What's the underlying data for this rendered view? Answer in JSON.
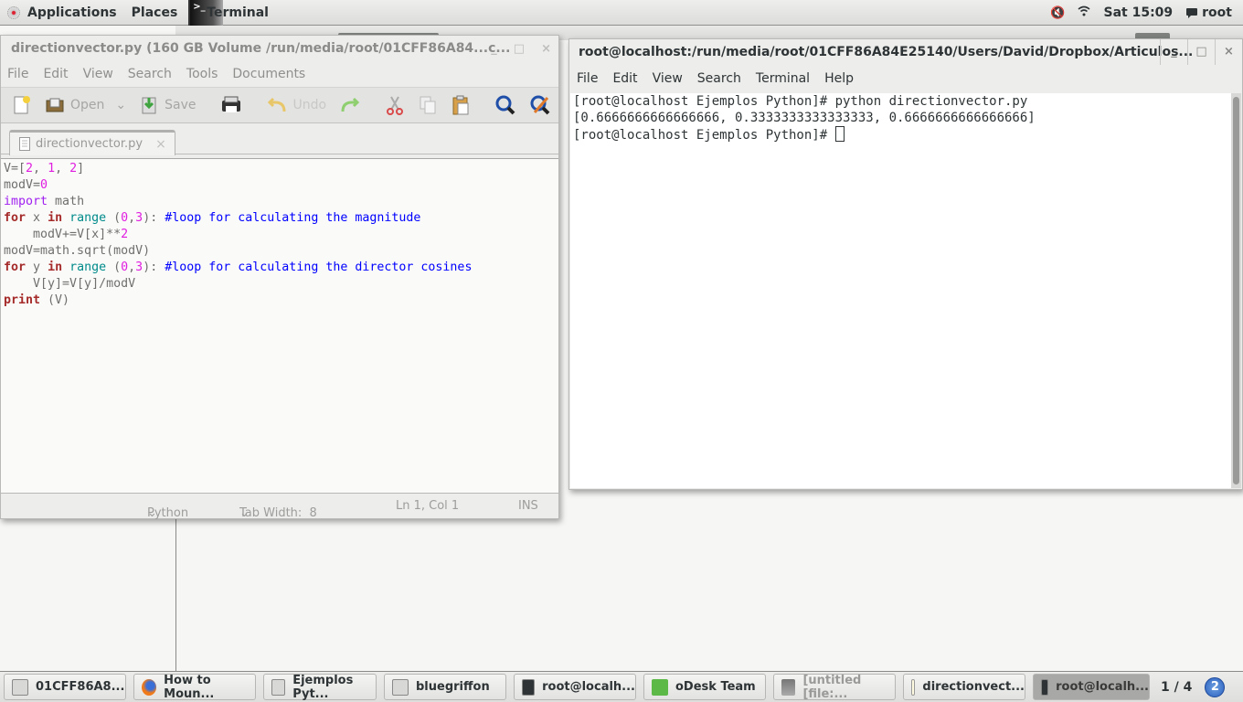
{
  "top_panel": {
    "applications": "Applications",
    "places": "Places",
    "active_app": "Terminal",
    "volume_icon": "volume-muted-icon",
    "wifi_icon": "wifi-icon",
    "clock": "Sat 15:09",
    "chat_icon": "chat-bubble-icon",
    "user": "root"
  },
  "gedit": {
    "title": "directionvector.py (160 GB Volume /run/media/root/01CFF86A84...c...",
    "controls": [
      "_",
      "□",
      "×"
    ],
    "menu": [
      "File",
      "Edit",
      "View",
      "Search",
      "Tools",
      "Documents"
    ],
    "toolbar": {
      "open": "Open",
      "save": "Save",
      "undo": "Undo"
    },
    "tab_label": "directionvector.py",
    "tab_close": "×",
    "code_lines": [
      "V=[2, 1, 2]",
      "modV=0",
      "import math",
      "for x in range (0,3): #loop for calculating the magnitude",
      "    modV+=V[x]**2",
      "modV=math.sqrt(modV)",
      "for y in range (0,3): #loop for calculating the director cosines",
      "    V[y]=V[y]/modV",
      "print (V)"
    ],
    "status": {
      "language": "Python",
      "tab_width": "Tab Width:  8",
      "position": "Ln 1, Col 1",
      "mode": "INS"
    }
  },
  "terminal": {
    "title": "root@localhost:/run/media/root/01CFF86A84E25140/Users/David/Dropbox/Articulos...",
    "controls": [
      "_",
      "□",
      "×"
    ],
    "menu": [
      "File",
      "Edit",
      "View",
      "Search",
      "Terminal",
      "Help"
    ],
    "lines": [
      "[root@localhost Ejemplos Python]# python directionvector.py",
      "[0.6666666666666666, 0.3333333333333333, 0.6666666666666666]",
      "[root@localhost Ejemplos Python]# "
    ]
  },
  "taskbar": {
    "items": [
      {
        "label": "01CFF86A8...",
        "icon": "file-manager-icon"
      },
      {
        "label": "How to Moun...",
        "icon": "firefox-icon"
      },
      {
        "label": "Ejemplos Pyt...",
        "icon": "file-manager-icon"
      },
      {
        "label": "bluegriffon",
        "icon": "file-manager-icon"
      },
      {
        "label": "root@localh...",
        "icon": "terminal-icon"
      },
      {
        "label": "oDesk Team",
        "icon": "odesk-icon"
      },
      {
        "label": "[untitled [file:...",
        "icon": "gimp-icon"
      },
      {
        "label": "directionvect...",
        "icon": "text-editor-icon"
      },
      {
        "label": "root@localh...",
        "icon": "terminal-icon"
      }
    ],
    "workspace": "1 / 4",
    "notification_count": "2"
  }
}
